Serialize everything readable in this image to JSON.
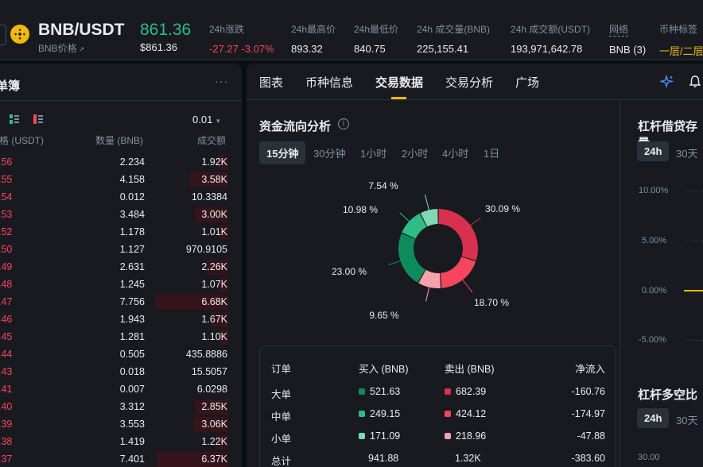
{
  "header": {
    "pair": "BNB/USDT",
    "sub_label": "BNB价格",
    "sub_ext": "↗",
    "last_price": "861.36",
    "last_price_usd": "$861.36",
    "stats": [
      {
        "label": "24h涨跌",
        "value": "-27.27 -3.07%",
        "color": "red"
      },
      {
        "label": "24h最高价",
        "value": "893.32"
      },
      {
        "label": "24h最低价",
        "value": "840.75"
      },
      {
        "label": "24h 成交量(BNB)",
        "value": "225,155.41"
      },
      {
        "label": "24h 成交额(USDT)",
        "value": "193,971,642.78"
      },
      {
        "label": "网络",
        "value": "BNB (3)"
      },
      {
        "label": "币种标签",
        "value": "一层/二层"
      }
    ]
  },
  "orderbook": {
    "title": "单簿",
    "more": "···",
    "precision": "0.01",
    "col_price": "格 (USDT)",
    "col_qty": "数量 (BNB)",
    "col_total": "成交额",
    "rows": [
      {
        "price": ".56",
        "qty": "2.234",
        "total": "1.92K",
        "depth": 0.06
      },
      {
        "price": ".55",
        "qty": "4.158",
        "total": "3.58K",
        "depth": 0.23
      },
      {
        "price": ".54",
        "qty": "0.012",
        "total": "10.3384",
        "depth": 0.0
      },
      {
        "price": ".53",
        "qty": "3.484",
        "total": "3.00K",
        "depth": 0.2
      },
      {
        "price": ".52",
        "qty": "1.178",
        "total": "1.01K",
        "depth": 0.05
      },
      {
        "price": ".50",
        "qty": "1.127",
        "total": "970.9105",
        "depth": 0.0
      },
      {
        "price": ".49",
        "qty": "2.631",
        "total": "2.26K",
        "depth": 0.13
      },
      {
        "price": ".48",
        "qty": "1.245",
        "total": "1.07K",
        "depth": 0.05
      },
      {
        "price": ".47",
        "qty": "7.756",
        "total": "6.68K",
        "depth": 0.44
      },
      {
        "price": ".46",
        "qty": "1.943",
        "total": "1.67K",
        "depth": 0.1
      },
      {
        "price": ".45",
        "qty": "1.281",
        "total": "1.10K",
        "depth": 0.05
      },
      {
        "price": ".44",
        "qty": "0.505",
        "total": "435.8886",
        "depth": 0.0
      },
      {
        "price": ".43",
        "qty": "0.018",
        "total": "15.5057",
        "depth": 0.0
      },
      {
        "price": ".41",
        "qty": "0.007",
        "total": "6.0298",
        "depth": 0.0
      },
      {
        "price": ".40",
        "qty": "3.312",
        "total": "2.85K",
        "depth": 0.2
      },
      {
        "price": ".39",
        "qty": "3.553",
        "total": "3.06K",
        "depth": 0.21
      },
      {
        "price": ".38",
        "qty": "1.419",
        "total": "1.22K",
        "depth": 0.07
      },
      {
        "price": ".37",
        "qty": "7.401",
        "total": "6.37K",
        "depth": 0.43
      }
    ]
  },
  "tabs": [
    "图表",
    "币种信息",
    "交易数据",
    "交易分析",
    "广场"
  ],
  "fund_flow": {
    "title": "资金流向分析",
    "intervals": [
      "15分钟",
      "30分钟",
      "1小时",
      "2小时",
      "4小时",
      "1日"
    ],
    "active_interval": "15分钟",
    "table": {
      "headers": [
        "订单",
        "买入 (BNB)",
        "卖出 (BNB)",
        "净流入"
      ],
      "rows": [
        {
          "label": "大单",
          "buy": "521.63",
          "sell": "682.39",
          "net": "-160.76"
        },
        {
          "label": "中单",
          "buy": "249.15",
          "sell": "424.12",
          "net": "-174.97"
        },
        {
          "label": "小单",
          "buy": "171.09",
          "sell": "218.96",
          "net": "-47.88"
        },
        {
          "label": "总计",
          "buy": "941.88",
          "sell": "1.32K",
          "net": "-383.60"
        }
      ]
    }
  },
  "chart_data": {
    "type": "pie",
    "categories": [
      "卖出-大单",
      "卖出-中单",
      "卖出-小单",
      "买入-小单",
      "买入-中单",
      "买入-大单"
    ],
    "values": [
      30.09,
      18.7,
      9.65,
      23.0,
      10.98,
      7.54
    ],
    "labels": [
      "30.09 %",
      "18.70 %",
      "9.65 %",
      "23.00 %",
      "10.98 %",
      "7.54 %"
    ],
    "colors": [
      "#d9304f",
      "#f6465d",
      "#f7a1ad",
      "#0e8b5c",
      "#2ebd85",
      "#7fd9b1"
    ]
  },
  "colors": {
    "sell_large": "#d9304f",
    "sell_mid": "#f6465d",
    "sell_small": "#f7a1ad",
    "buy_large": "#0e8b5c",
    "buy_mid": "#2ebd85",
    "buy_small": "#7fd9b1",
    "accent": "#f0b90b"
  },
  "margin": {
    "title": "杠杆借贷存量",
    "intervals": [
      "24h",
      "30天"
    ],
    "yticks": [
      "10.00%",
      "5.00%",
      "0.00%",
      "-5.00%"
    ]
  },
  "ls_ratio": {
    "title": "杠杆多空比",
    "intervals": [
      "24h",
      "30天"
    ],
    "ytick": "30.00"
  }
}
